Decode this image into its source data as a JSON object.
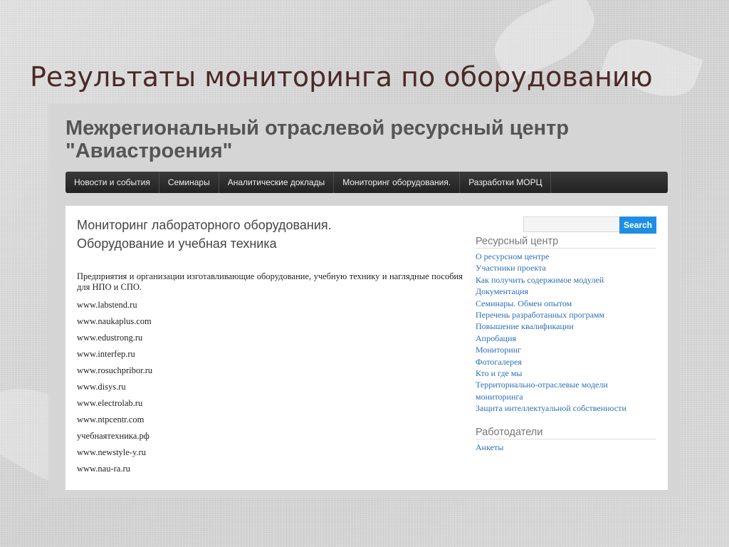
{
  "slide": {
    "title": "Результаты мониторинга по оборудованию"
  },
  "site": {
    "title_line1": "Межрегиональный отраслевой ресурсный центр",
    "title_line2": "\"Авиастроения\""
  },
  "nav": {
    "items": [
      "Новости и события",
      "Семинары",
      "Аналитические доклады",
      "Мониторинг оборудования.",
      "Разработки МОРЦ"
    ]
  },
  "main": {
    "heading1": "Мониторинг лабораторного оборудования.",
    "heading2": "Оборудование и учебная техника",
    "intro": "Предприятия и организации изготавливающие оборудование, учебную технику и наглядные пособия для НПО и СПО.",
    "links": [
      "www.labstend.ru",
      "www.naukaplus.com",
      "www.edustrong.ru",
      "www.interfep.ru",
      "www.rosuchpribor.ru",
      "www.disys.ru",
      "www.electrolab.ru",
      "www.ntpcentr.com",
      "учебнаятехника.рф",
      "www.newstyle-y.ru",
      "www.nau-ra.ru"
    ]
  },
  "sidebar": {
    "search_button": "Search",
    "search_placeholder": "",
    "section1_title": "Ресурсный центр",
    "section1_links": [
      "О ресурсном центре",
      "Участники проекта",
      "Как получить содержимое модулей",
      "Документация",
      "Семинары. Обмен опытом",
      "Перечень разработанных программ",
      "Повышение квалификации",
      "Апробация",
      "Мониторинг",
      "Фотогалерея",
      "Кто и где мы",
      "Территориально-отраслевые модели мониторинга",
      "Защита интеллектуальной собственности"
    ],
    "section2_title": "Работодатели",
    "section2_links": [
      "Анкеты"
    ]
  },
  "colors": {
    "slide_title": "#4a2a26",
    "link": "#2a6fb8",
    "search_button": "#1e8ee4",
    "navbar": "#2b2b2b"
  }
}
